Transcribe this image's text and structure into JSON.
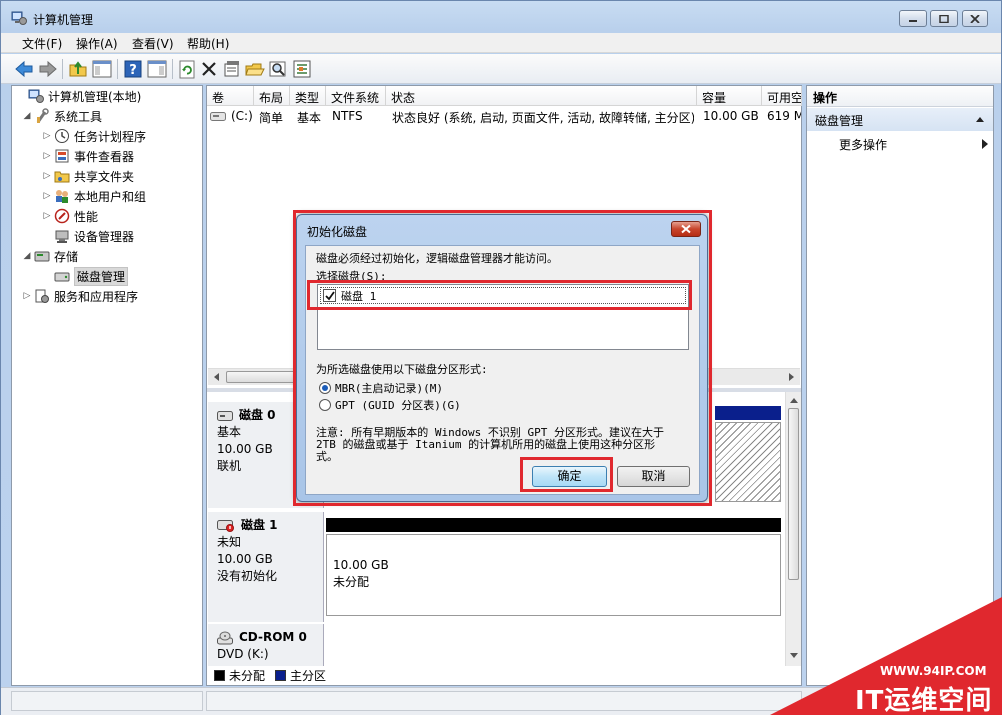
{
  "window": {
    "title": "计算机管理"
  },
  "menu": [
    "文件(F)",
    "操作(A)",
    "查看(V)",
    "帮助(H)"
  ],
  "tree": [
    {
      "label": "计算机管理(本地)",
      "icon": "computer-management-icon",
      "twisty": ""
    },
    {
      "label": "系统工具",
      "icon": "tools-icon",
      "twisty": "◢"
    },
    {
      "label": "任务计划程序",
      "icon": "clock-icon",
      "twisty": "▷"
    },
    {
      "label": "事件查看器",
      "icon": "event-viewer-icon",
      "twisty": "▷"
    },
    {
      "label": "共享文件夹",
      "icon": "shared-folder-icon",
      "twisty": "▷"
    },
    {
      "label": "本地用户和组",
      "icon": "users-icon",
      "twisty": "▷"
    },
    {
      "label": "性能",
      "icon": "performance-icon",
      "twisty": "▷"
    },
    {
      "label": "设备管理器",
      "icon": "device-manager-icon",
      "twisty": ""
    },
    {
      "label": "存储",
      "icon": "storage-icon",
      "twisty": "◢"
    },
    {
      "label": "磁盘管理",
      "icon": "disk-management-icon",
      "twisty": ""
    },
    {
      "label": "服务和应用程序",
      "icon": "services-icon",
      "twisty": "▷"
    }
  ],
  "volumes": {
    "columns": [
      "卷",
      "布局",
      "类型",
      "文件系统",
      "状态",
      "容量",
      "可用空"
    ],
    "rows": [
      [
        "(C:)",
        "简单",
        "基本",
        "NTFS",
        "状态良好 (系统, 启动, 页面文件, 活动, 故障转储, 主分区)",
        "10.00 GB",
        "619 M"
      ]
    ]
  },
  "disks": [
    {
      "name": "磁盘 0",
      "type": "基本",
      "size": "10.00 GB",
      "state": "联机"
    },
    {
      "name": "磁盘 1",
      "type": "未知",
      "size": "10.00 GB",
      "state": "没有初始化",
      "part_size": "10.00 GB",
      "part_state": "未分配"
    },
    {
      "name": "CD-ROM 0",
      "type": "DVD (K:)"
    }
  ],
  "legend": {
    "unallocated": "未分配",
    "primary": "主分区"
  },
  "actions": {
    "header": "操作",
    "group": "磁盘管理",
    "more": "更多操作"
  },
  "dialog": {
    "title": "初始化磁盘",
    "intro": "磁盘必须经过初始化，逻辑磁盘管理器才能访问。",
    "select_label": "选择磁盘(S):",
    "disk_item": "磁盘 1",
    "style_label": "为所选磁盘使用以下磁盘分区形式:",
    "option_mbr": "MBR(主启动记录)(M)",
    "option_gpt": "GPT (GUID 分区表)(G)",
    "note_lines": [
      "注意: 所有早期版本的 Windows 不识别 GPT 分区形式。建议在大于",
      "2TB 的磁盘或基于 Itanium 的计算机所用的磁盘上使用这种分区形",
      "式。"
    ],
    "ok": "确定",
    "cancel": "取消"
  },
  "watermark": {
    "url": "WWW.94IP.COM",
    "brand": "IT运维空间"
  },
  "colors": {
    "highlight": "#e0282e",
    "primary_partition": "#0a1f8c",
    "unallocated": "#000000"
  }
}
